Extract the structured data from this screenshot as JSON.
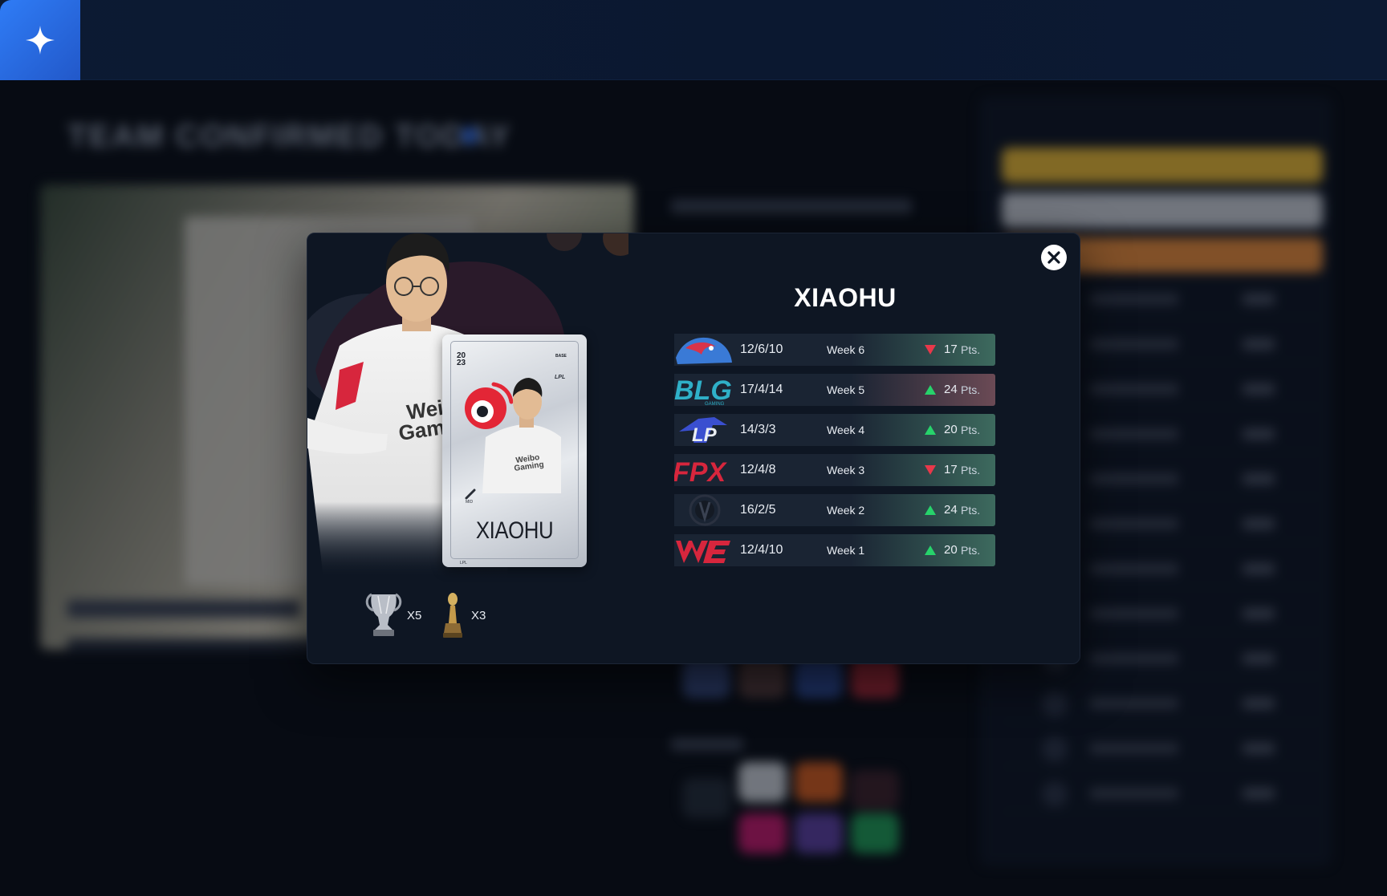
{
  "app": {
    "logo_icon": "sparkle-icon",
    "accent_color": "#2f7cf6"
  },
  "background_page": {
    "heading": "TEAM CONFIRMED TODAY"
  },
  "modal": {
    "close_icon": "close-icon",
    "player": {
      "name": "XIAOHU",
      "card": {
        "year_top": "20",
        "year_bottom": "23",
        "edition": "BASE",
        "league": "LPL",
        "name": "XIAOHU",
        "role": "MID",
        "footer_league": "LPL"
      },
      "trophies": [
        {
          "icon": "world-cup-trophy-icon",
          "count": "X5"
        },
        {
          "icon": "msi-trophy-icon",
          "count": "X3"
        }
      ]
    },
    "matches": [
      {
        "team": "JDG",
        "kda": "12/6/10",
        "week": "Week 6",
        "trend": "down",
        "points": "17",
        "unit": "Pts."
      },
      {
        "team": "BLG",
        "kda": "17/4/14",
        "week": "Week 5",
        "trend": "up",
        "points": "24",
        "unit": "Pts."
      },
      {
        "team": "LNG",
        "kda": "14/3/3",
        "week": "Week 4",
        "trend": "up",
        "points": "20",
        "unit": "Pts."
      },
      {
        "team": "FPX",
        "kda": "12/4/8",
        "week": "Week 3",
        "trend": "down",
        "points": "17",
        "unit": "Pts."
      },
      {
        "team": "IG",
        "kda": "16/2/5",
        "week": "Week 2",
        "trend": "up",
        "points": "24",
        "unit": "Pts."
      },
      {
        "team": "WE",
        "kda": "12/4/10",
        "week": "Week 1",
        "trend": "up",
        "points": "20",
        "unit": "Pts."
      }
    ],
    "colors": {
      "up": "#27d36b",
      "down": "#e8384a"
    }
  }
}
